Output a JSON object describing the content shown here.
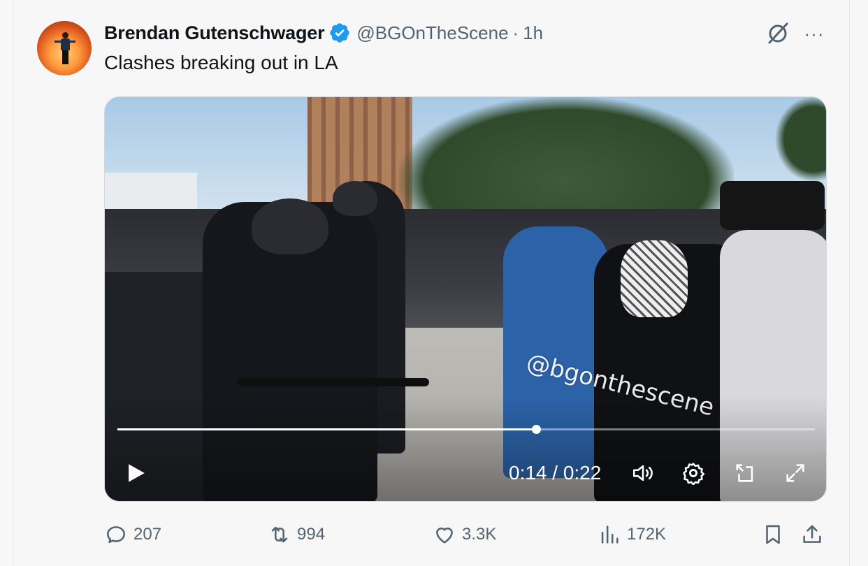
{
  "author": {
    "name": "Brendan Gutenschwager",
    "handle": "@BGOnTheScene",
    "separator": "·",
    "time": "1h",
    "verified": true,
    "avatar_icon": "avatar"
  },
  "tweet": {
    "text": "Clashes breaking out in LA"
  },
  "header_icons": {
    "grok": "grok-icon",
    "more": "more-icon",
    "more_glyph": "···"
  },
  "video": {
    "watermark": "@bgonthescene",
    "current_time": "0:14",
    "duration": "0:22",
    "timecode": "0:14 / 0:22",
    "progress_fraction": 0.6
  },
  "actions": {
    "replies": "207",
    "reposts": "994",
    "likes": "3.3K",
    "views": "172K"
  },
  "colors": {
    "text_primary": "#0f1419",
    "text_secondary": "#536471",
    "verified_blue": "#1d9bf0",
    "background": "#f7f7f7"
  }
}
